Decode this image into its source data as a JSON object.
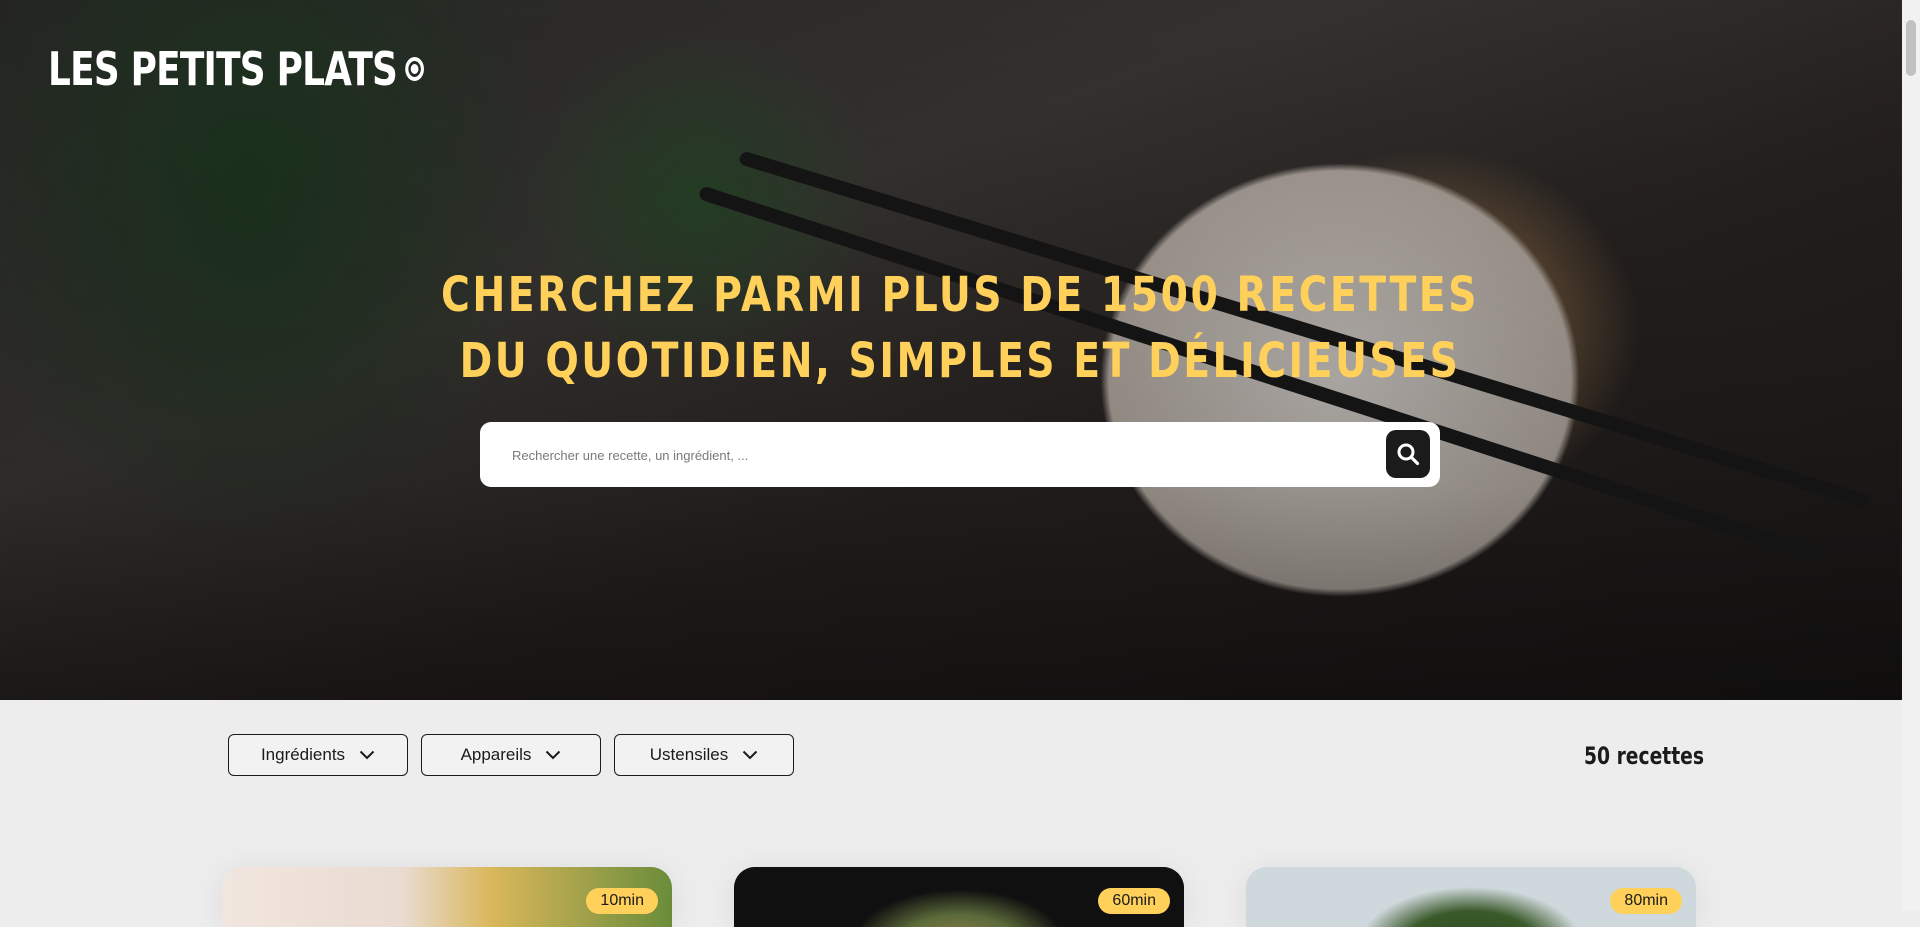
{
  "header": {
    "logo": "LES PETITS PLATS",
    "headline_line1": "CHERCHEZ PARMI PLUS DE 1500 RECETTES",
    "headline_line2": "DU QUOTIDIEN, SIMPLES ET DÉLICIEUSES"
  },
  "search": {
    "placeholder": "Rechercher une recette, un ingrédient, ...",
    "value": "",
    "button_icon": "search-icon"
  },
  "filters": [
    {
      "label": "Ingrédients",
      "icon": "chevron-down-icon"
    },
    {
      "label": "Appareils",
      "icon": "chevron-down-icon"
    },
    {
      "label": "Ustensiles",
      "icon": "chevron-down-icon"
    }
  ],
  "results": {
    "count_label": "50 recettes"
  },
  "recipes": [
    {
      "time": "10min"
    },
    {
      "time": "60min"
    },
    {
      "time": "80min"
    }
  ],
  "colors": {
    "accent": "#FFD15B",
    "dark": "#1B1B1B",
    "background": "#EDEDED"
  }
}
